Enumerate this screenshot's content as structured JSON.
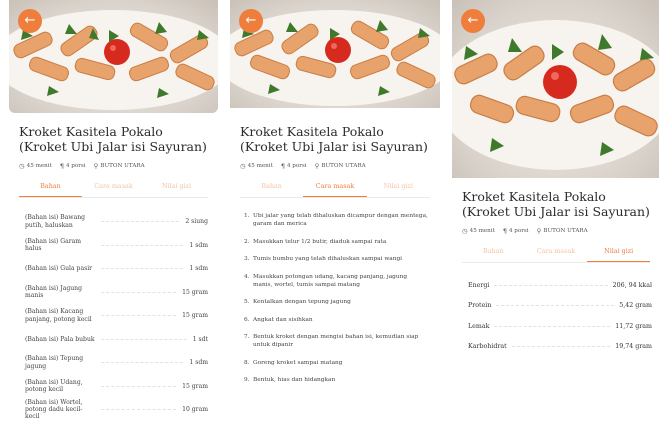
{
  "recipe": {
    "title": "Kroket Kasitela Pokalo (Kroket Ubi Jalar isi Sayuran)",
    "time": "45 menit",
    "portion": "4 porsi",
    "region": "BUTON UTARA"
  },
  "tabs": [
    "Bahan",
    "Cara masak",
    "Nilai gizi"
  ],
  "ingredients": [
    {
      "name": "(Bahan isi) Bawang putih, haluskan",
      "qty": "2 siung"
    },
    {
      "name": "(Bahan isi) Garam halus",
      "qty": "1 sdm"
    },
    {
      "name": "(Bahan isi) Gula pasir",
      "qty": "1 sdm"
    },
    {
      "name": "(Bahan isi) Jagung manis",
      "qty": "15 gram"
    },
    {
      "name": "(Bahan isi) Kacang panjang, potong kecil",
      "qty": "15 gram"
    },
    {
      "name": "(Bahan isi) Pala bubuk",
      "qty": "1 sdt"
    },
    {
      "name": "(Bahan isi) Tepung jagung",
      "qty": "1 sdm"
    },
    {
      "name": "(Bahan isi) Udang, potong kecil",
      "qty": "15 gram"
    },
    {
      "name": "(Bahan isi) Wortel, potong dadu kecil-kecil",
      "qty": "10 gram"
    }
  ],
  "steps": [
    {
      "num": "1.",
      "text": "Ubi jalar yang telah dihaluskan dicampur dengan mentega, garam dan merica"
    },
    {
      "num": "2.",
      "text": "Masukkan telur 1/2 butir, diaduk sampai rata"
    },
    {
      "num": "3.",
      "text": "Tumis bumbu yang telah dihaluskan sampai wangi"
    },
    {
      "num": "4.",
      "text": "Masukkan potongan udang, kacang panjang, jagung manis, wortel, tumis sampai matang"
    },
    {
      "num": "5.",
      "text": "Kentalkan dengan tepung jagung"
    },
    {
      "num": "6.",
      "text": "Angkat dan sisihkan"
    },
    {
      "num": "7.",
      "text": "Bentuk kroket dengan mengisi bahan isi, kemudian siap untuk dipanir"
    },
    {
      "num": "8.",
      "text": "Goreng kroket sampai matang"
    },
    {
      "num": "9.",
      "text": "Bentuk, hias dan hidangkan"
    }
  ],
  "nutrition": [
    {
      "name": "Energi",
      "value": "206, 94 kkal"
    },
    {
      "name": "Protein",
      "value": "5,42 gram"
    },
    {
      "name": "Lemak",
      "value": "11,72 gram"
    },
    {
      "name": "Karbohidrat",
      "value": "19,74 gram"
    }
  ],
  "icons": {
    "back": "arrow-left-icon",
    "time": "clock-icon",
    "portion": "utensils-icon",
    "region": "location-pin-icon"
  },
  "colors": {
    "accent": "#ef7d3c",
    "accent_light": "#f4c3a5",
    "text": "#333333"
  }
}
